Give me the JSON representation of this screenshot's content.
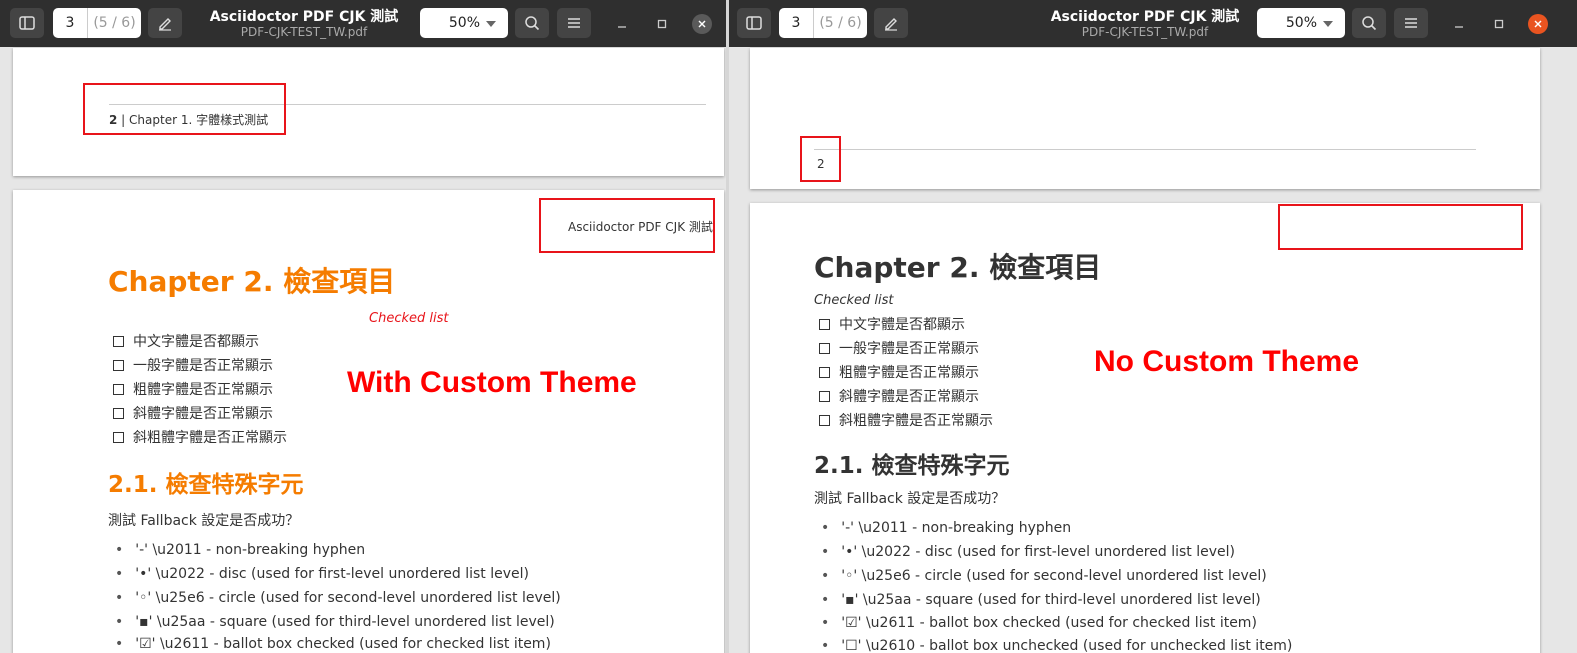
{
  "left": {
    "header": {
      "title": "Asciidoctor PDF CJK 測試",
      "subtitle": "PDF-CJK-TEST_TW.pdf",
      "page_current": "3",
      "page_total": "(5 / 6)",
      "zoom": "50%",
      "min_glyph": "–",
      "max_glyph": "☐",
      "close_glyph": "✕"
    },
    "footer": {
      "page_num": "2",
      "label": " | Chapter 1. 字體樣式測試"
    },
    "running_header": "Asciidoctor PDF CJK 測試",
    "chapter_title": "Chapter 2. 檢查項目",
    "checked_list_title": "Checked list",
    "overlay_label": "With Custom Theme",
    "checklist": [
      "中文字體是否都顯示",
      "一般字體是否正常顯示",
      "粗體字體是否正常顯示",
      "斜體字體是否正常顯示",
      "斜粗體字體是否正常顯示"
    ],
    "section_title": "2.1. 檢查特殊字元",
    "intro": "測試 Fallback 設定是否成功？",
    "bullets": [
      "'‑' \\u2011 - non-breaking hyphen",
      "'•' \\u2022 - disc (used for first-level unordered list level)",
      "'◦' \\u25e6 - circle (used for second-level unordered list level)",
      "'▪' \\u25aa - square (used for third-level unordered list level)",
      "'☑' \\u2611 - ballot box checked (used for checked list item)"
    ],
    "colors": {
      "heading": "#f57c00",
      "checked_title": "#e8141a"
    }
  },
  "right": {
    "header": {
      "title": "Asciidoctor PDF CJK 測試",
      "subtitle": "PDF-CJK-TEST_TW.pdf",
      "page_current": "3",
      "page_total": "(5 / 6)",
      "zoom": "50%",
      "min_glyph": "–",
      "max_glyph": "☐",
      "close_glyph": "✕"
    },
    "footer": {
      "page_num": "2"
    },
    "chapter_title": "Chapter 2. 檢查項目",
    "checked_list_title": "Checked list",
    "overlay_label": "No Custom Theme",
    "checklist": [
      "中文字體是否都顯示",
      "一般字體是否正常顯示",
      "粗體字體是否正常顯示",
      "斜體字體是否正常顯示",
      "斜粗體字體是否正常顯示"
    ],
    "section_title": "2.1. 檢查特殊字元",
    "intro": "測試 Fallback 設定是否成功？",
    "bullets": [
      "'‑' \\u2011 - non-breaking hyphen",
      "'•' \\u2022 - disc (used for first-level unordered list level)",
      "'◦' \\u25e6 - circle (used for second-level unordered list level)",
      "'▪' \\u25aa - square (used for third-level unordered list level)",
      "'☑' \\u2611 - ballot box checked (used for checked list item)",
      "'☐' \\u2610 - ballot box unchecked (used for unchecked list item)"
    ],
    "colors": {
      "heading": "#333333",
      "close_btn": "#e95420"
    }
  },
  "icons": {
    "sidebar": "sidebar-toggle-icon",
    "annotate": "annotate-pen-icon",
    "search": "search-icon",
    "menu": "hamburger-menu-icon",
    "minimize": "minimize-icon",
    "maximize": "maximize-icon",
    "close": "close-icon",
    "bullet": "•"
  }
}
